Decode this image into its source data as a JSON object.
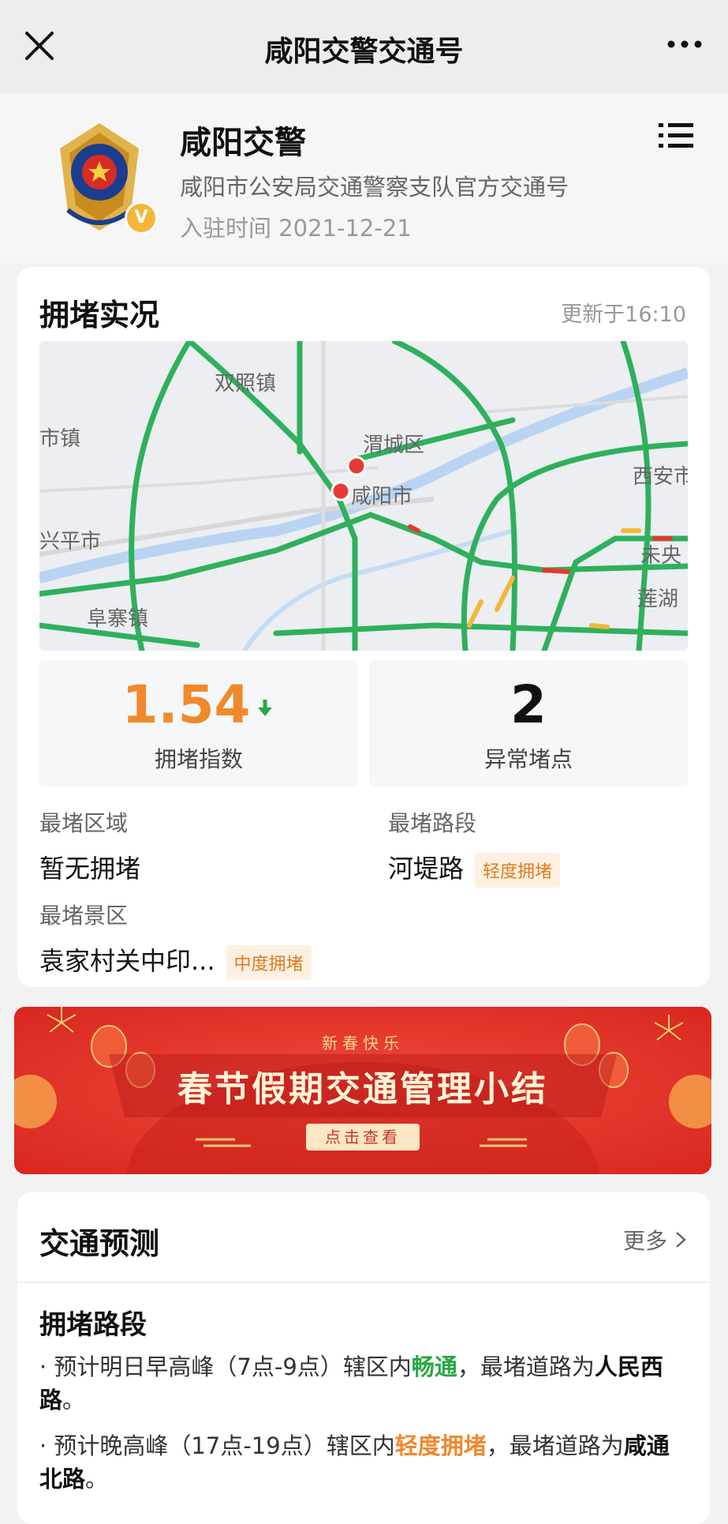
{
  "nav": {
    "title": "咸阳交警交通号"
  },
  "profile": {
    "name": "咸阳交警",
    "desc": "咸阳市公安局交通警察支队官方交通号",
    "join": "入驻时间 2021-12-21",
    "badge": "V"
  },
  "congestion": {
    "title": "拥堵实况",
    "updated": "更新于16:10",
    "map_labels": [
      "双照镇",
      "渭城区",
      "咸阳市",
      "西安市",
      "未央",
      "莲湖",
      "兴平市",
      "阜寨镇",
      "市镇"
    ],
    "index_value": "1.54",
    "index_label": "拥堵指数",
    "abnormal_value": "2",
    "abnormal_label": "异常堵点",
    "worst_area_label": "最堵区域",
    "worst_area_value": "暂无拥堵",
    "worst_road_label": "最堵路段",
    "worst_road_value": "河堤路",
    "worst_road_tag": "轻度拥堵",
    "worst_scenic_label": "最堵景区",
    "worst_scenic_value": "袁家村关中印...",
    "worst_scenic_tag": "中度拥堵"
  },
  "banner": {
    "subtitle": "新春快乐",
    "title": "春节假期交通管理小结",
    "button": "点击查看"
  },
  "forecast": {
    "title": "交通预测",
    "more": "更多",
    "subtitle": "拥堵路段",
    "line1_a": "· 预计明日早高峰（7点-9点）辖区内",
    "line1_status": "畅通",
    "line1_b": "，最堵道路为",
    "line1_road": "人民西路",
    "line1_end": "。",
    "line2_a": "· 预计晚高峰（17点-19点）辖区内",
    "line2_status": "轻度拥堵",
    "line2_b": "，最堵道路为",
    "line2_road": "咸通北路",
    "line2_end": "。"
  },
  "colors": {
    "accent_orange": "#f0892b",
    "road_green": "#2fb05c",
    "banner_red": "#e5342e",
    "status_green": "#28a745"
  },
  "icons": [
    "close-icon",
    "more-dots-icon",
    "list-menu-icon",
    "police-emblem-icon",
    "verified-badge-icon",
    "arrow-down-icon",
    "chevron-right-icon"
  ]
}
